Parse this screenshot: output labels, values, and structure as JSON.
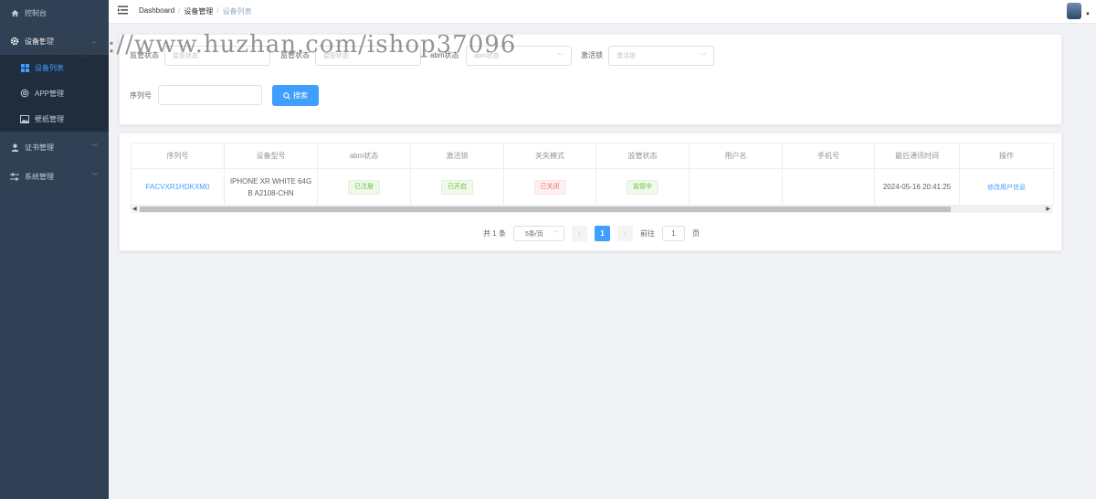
{
  "sidebar": {
    "items": [
      {
        "label": "控制台",
        "icon": "home-icon"
      },
      {
        "label": "设备管理",
        "icon": "gear-icon"
      },
      {
        "label": "设备列表",
        "icon": "grid-icon"
      },
      {
        "label": "APP管理",
        "icon": "app-icon"
      },
      {
        "label": "壁纸管理",
        "icon": "image-icon"
      },
      {
        "label": "证书管理",
        "icon": "user-icon"
      },
      {
        "label": "系统管理",
        "icon": "sliders-icon"
      }
    ]
  },
  "header": {
    "breadcrumb": [
      "Dashboard",
      "设备管理",
      "设备列表"
    ],
    "separator": "/"
  },
  "filters": {
    "field1_label": "监管状态",
    "field1_placeholder": "监管状态",
    "field2_label": "监管状态",
    "field2_placeholder": "监管状态",
    "abm_label": "abm状态",
    "abm_placeholder": "abm状态",
    "activation_label": "激活锁",
    "activation_placeholder": "激活锁",
    "serial_label": "序列号",
    "serial_value": "",
    "search_button": "搜索"
  },
  "table": {
    "columns": [
      "序列号",
      "设备型号",
      "abm状态",
      "激活锁",
      "关失模式",
      "监管状态",
      "用户名",
      "手机号",
      "最后通讯时间",
      "操作"
    ],
    "rows": [
      {
        "serial": "FACVXR1HDKXM0",
        "model_line1": "IPHONE XR WHITE 64G",
        "model_line2": "B A2108-CHN",
        "abm_status": "已注册",
        "activation_lock": "已开启",
        "lost_mode": "已关闭",
        "supervision": "监管中",
        "username": "",
        "phone": "",
        "last_comm": "2024-05-16 20:41:25",
        "action": "修改用户信息"
      }
    ]
  },
  "pagination": {
    "total_text": "共 1 条",
    "page_size": "5条/页",
    "prev": "‹",
    "current_page": "1",
    "next": "›",
    "goto_prefix": "前往",
    "goto_value": "1",
    "goto_suffix": "页"
  },
  "watermark": {
    "text": "https://www.huzhan.com/ishop37096"
  },
  "colors": {
    "sidebar_bg": "#304156",
    "primary": "#409eff",
    "success": "#67c23a",
    "danger": "#f56c6c"
  }
}
